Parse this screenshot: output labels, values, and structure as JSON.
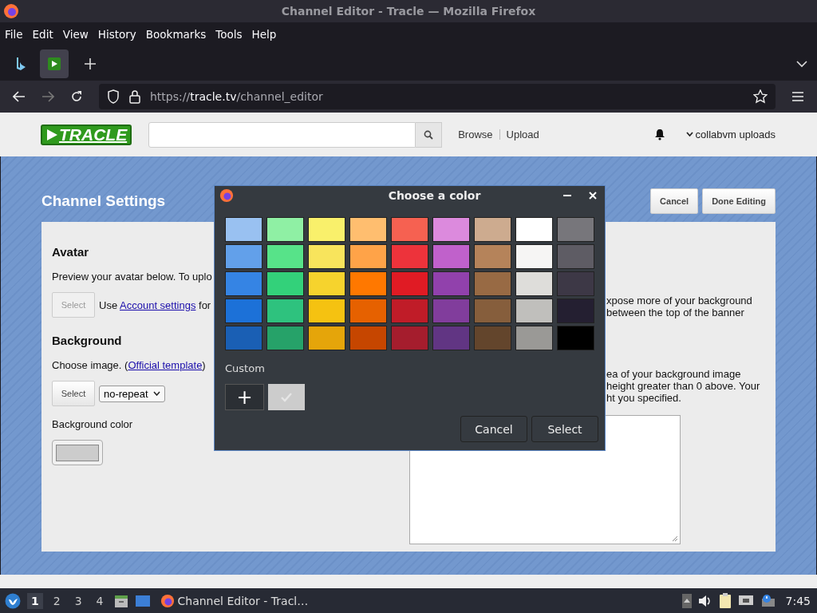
{
  "window": {
    "title": "Channel Editor - Tracle — Mozilla Firefox"
  },
  "menu": [
    "File",
    "Edit",
    "View",
    "History",
    "Bookmarks",
    "Tools",
    "Help"
  ],
  "tabs": [
    {
      "kind": "bing",
      "selected": false
    },
    {
      "kind": "play",
      "selected": true
    }
  ],
  "address": {
    "scheme": "https://",
    "host": "tracle.tv",
    "path": "/channel_editor"
  },
  "site": {
    "logo": "TRACLE",
    "nav": [
      "Browse",
      "Upload"
    ],
    "user": "collabvm uploads"
  },
  "page": {
    "title": "Channel Settings",
    "buttons": [
      "Cancel",
      "Done Editing"
    ],
    "avatar": {
      "heading": "Avatar",
      "text": "Preview your avatar below. To uplo",
      "button": "Select",
      "note": {
        "before": "Use",
        "link": "Account settings",
        "after": "for"
      }
    },
    "background": {
      "heading": "Background",
      "text": {
        "before": "Choose image. (",
        "link": "Official template",
        "after": ")"
      },
      "button": "Select",
      "repeat": "no-repeat",
      "color_label": "Background color",
      "color": "#cccccc"
    },
    "right_texts": [
      "xpose more of your background\nbetween the top of the banner",
      "ea of your background image\n height greater than 0 above. Your\nht you specified."
    ]
  },
  "dialog": {
    "title": "Choose a color",
    "palette": [
      [
        {
          "color": "#99c1f1",
          "selected": false
        },
        {
          "color": "#8ff0a4",
          "selected": false
        },
        {
          "color": "#f9f06b",
          "selected": false
        },
        {
          "color": "#ffbe6f",
          "selected": false
        },
        {
          "color": "#f66151",
          "selected": false
        },
        {
          "color": "#dc8add",
          "selected": false
        },
        {
          "color": "#cdab8f",
          "selected": false
        },
        {
          "color": "#ffffff",
          "selected": false
        },
        {
          "color": "#77767b",
          "selected": false
        }
      ],
      [
        {
          "color": "#62a0ea",
          "selected": false
        },
        {
          "color": "#57e389",
          "selected": false
        },
        {
          "color": "#f8e45c",
          "selected": false
        },
        {
          "color": "#ffa348",
          "selected": false
        },
        {
          "color": "#ed333b",
          "selected": false
        },
        {
          "color": "#c061cb",
          "selected": false
        },
        {
          "color": "#b5835a",
          "selected": false
        },
        {
          "color": "#f6f5f4",
          "selected": false
        },
        {
          "color": "#5e5c64",
          "selected": false
        }
      ],
      [
        {
          "color": "#3584e4",
          "selected": false
        },
        {
          "color": "#33d17a",
          "selected": false
        },
        {
          "color": "#f6d32d",
          "selected": false
        },
        {
          "color": "#ff7800",
          "selected": false
        },
        {
          "color": "#e01b24",
          "selected": false
        },
        {
          "color": "#9141ac",
          "selected": false
        },
        {
          "color": "#986a44",
          "selected": false
        },
        {
          "color": "#deddda",
          "selected": false
        },
        {
          "color": "#3d3846",
          "selected": false
        }
      ],
      [
        {
          "color": "#1c71d8",
          "selected": false
        },
        {
          "color": "#2ec27e",
          "selected": false
        },
        {
          "color": "#f5c211",
          "selected": false
        },
        {
          "color": "#e66100",
          "selected": false
        },
        {
          "color": "#c01c28",
          "selected": false
        },
        {
          "color": "#813d9c",
          "selected": false
        },
        {
          "color": "#865e3c",
          "selected": false
        },
        {
          "color": "#c0bfbc",
          "selected": false
        },
        {
          "color": "#241f31",
          "selected": false
        }
      ],
      [
        {
          "color": "#1a5fb4",
          "selected": false
        },
        {
          "color": "#26a269",
          "selected": false
        },
        {
          "color": "#e5a50a",
          "selected": false
        },
        {
          "color": "#c64600",
          "selected": false
        },
        {
          "color": "#a51d2d",
          "selected": false
        },
        {
          "color": "#613583",
          "selected": false
        },
        {
          "color": "#63452c",
          "selected": false
        },
        {
          "color": "#9a9996",
          "selected": false
        },
        {
          "color": "#000000",
          "selected": false
        }
      ]
    ],
    "custom_label": "Custom",
    "add": "+",
    "custom": [
      {
        "color": "#cccccc",
        "selected": true
      }
    ],
    "buttons": [
      "Cancel",
      "Select"
    ]
  },
  "taskbar": {
    "workspaces": [
      {
        "label": "1",
        "selected": true
      },
      {
        "label": "2",
        "selected": false
      },
      {
        "label": "3",
        "selected": false
      },
      {
        "label": "4",
        "selected": false
      }
    ],
    "task": "Channel Editor - Tracl…",
    "clock": "7:45"
  }
}
